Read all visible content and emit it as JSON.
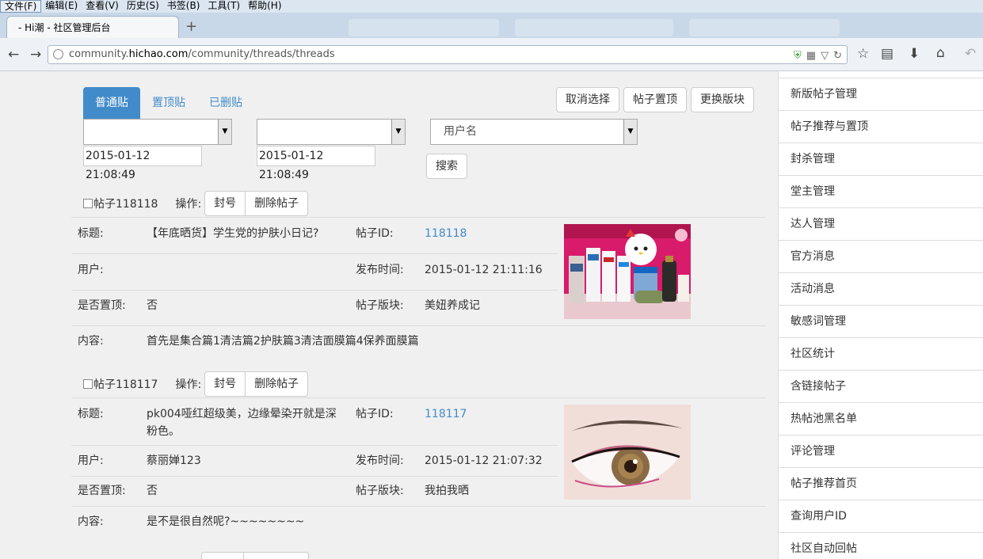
{
  "browser": {
    "menu": [
      "文件(F)",
      "编辑(E)",
      "查看(V)",
      "历史(S)",
      "书签(B)",
      "工具(T)",
      "帮助(H)"
    ],
    "tab_title": "- Hi潮 - 社区管理后台",
    "new_tab_glyph": "+",
    "url_prefix": "community.",
    "url_domain": "hichao.com",
    "url_path": "/community/threads/threads"
  },
  "tabs": [
    "普通贴",
    "置顶贴",
    "已删贴"
  ],
  "actions": {
    "cancel_select": "取消选择",
    "pin_post": "帖子置顶",
    "change_board": "更换版块"
  },
  "filters": {
    "select1": "",
    "select2": "",
    "date1": "2015-01-12 21:08:49",
    "date2": "2015-01-12 21:08:49",
    "user_select": "用户名",
    "search_button": "搜索"
  },
  "labels": {
    "op": "操作:",
    "ban": "封号",
    "delete": "删除帖子",
    "title": "标题:",
    "post_id": "帖子ID:",
    "user": "用户:",
    "publish_time": "发布时间:",
    "pinned": "是否置顶:",
    "board": "帖子版块:",
    "content": "内容:"
  },
  "posts": [
    {
      "header": "帖子118118",
      "title": "【年底晒货】学生党的护肤小日记?",
      "id": "118118",
      "user": "",
      "time": "2015-01-12 21:11:16",
      "pinned": "否",
      "board": "美妞养成记",
      "content": "首先是集合篇1清洁篇2护肤篇3清洁面膜篇4保养面膜篇"
    },
    {
      "header": "帖子118117",
      "title": "pk004哑红超级美，边缘晕染开就是深粉色。",
      "id": "118117",
      "user": "蔡丽婵123",
      "time": "2015-01-12 21:07:32",
      "pinned": "否",
      "board": "我拍我晒",
      "content": "是不是很自然呢?~~~~~~~~"
    }
  ],
  "sidebar": [
    "新版帖子管理",
    "帖子推荐与置顶",
    "封杀管理",
    "堂主管理",
    "达人管理",
    "官方消息",
    "活动消息",
    "敏感词管理",
    "社区统计",
    "含链接帖子",
    "热帖池黑名单",
    "评论管理",
    "帖子推荐首页",
    "查询用户ID",
    "社区自动回帖"
  ],
  "icons": [
    "back-icon",
    "forward-icon",
    "globe-icon",
    "shield-icon",
    "qr-icon",
    "reload-icon",
    "star-icon",
    "reading-list-icon",
    "download-icon",
    "home-icon",
    "undo-icon"
  ]
}
